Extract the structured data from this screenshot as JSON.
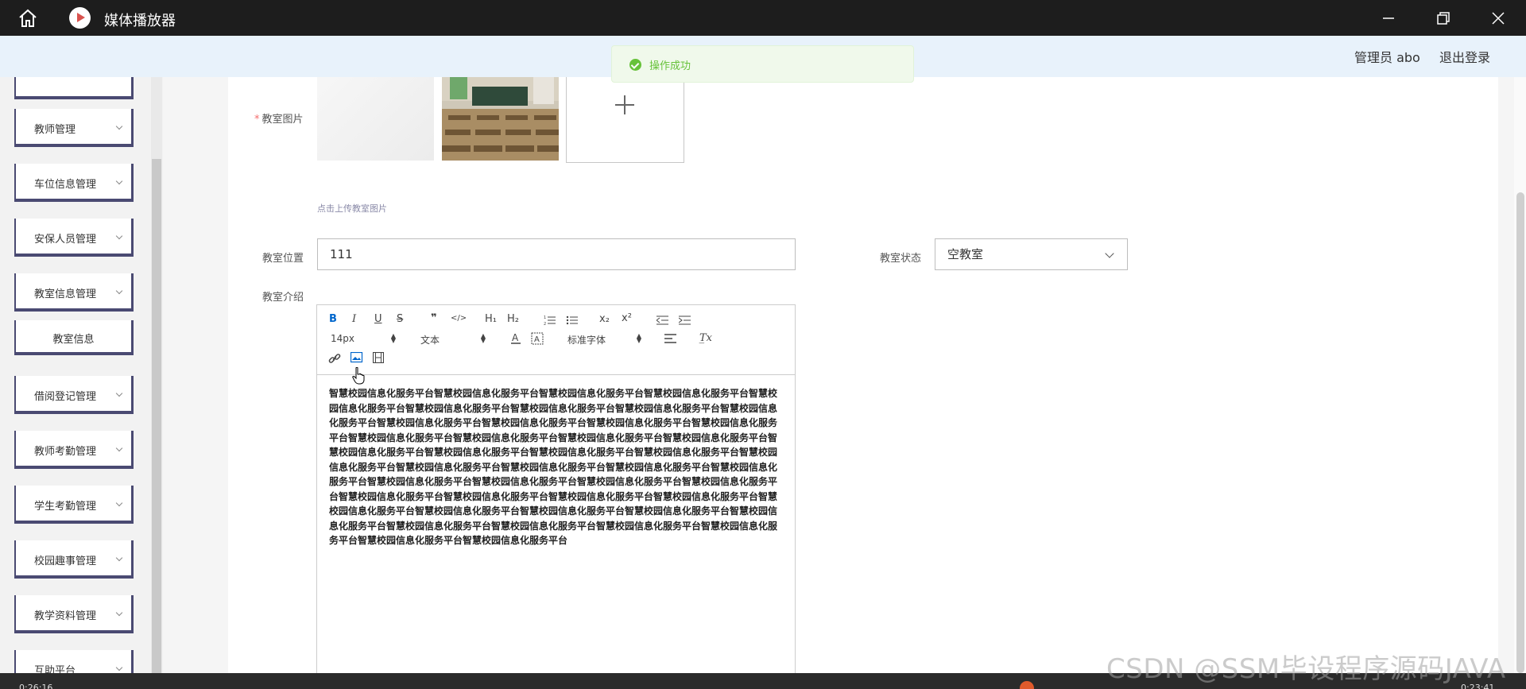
{
  "window": {
    "title": "媒体播放器",
    "minimize_icon": "minimize-icon",
    "maximize_icon": "restore-icon",
    "close_icon": "close-icon"
  },
  "header": {
    "admin_label": "管理员 abo",
    "logout_label": "退出登录"
  },
  "toast": {
    "message": "操作成功",
    "color": "#67c23a"
  },
  "sidebar": {
    "items": [
      {
        "label": ""
      },
      {
        "label": "教师管理"
      },
      {
        "label": "车位信息管理"
      },
      {
        "label": "安保人员管理"
      },
      {
        "label": "教室信息管理"
      },
      {
        "label": "教室信息"
      },
      {
        "label": "借阅登记管理"
      },
      {
        "label": "教师考勤管理"
      },
      {
        "label": "学生考勤管理"
      },
      {
        "label": "校园趣事管理"
      },
      {
        "label": "教学资料管理"
      },
      {
        "label": "互助平台"
      }
    ]
  },
  "form": {
    "image_label": "教室图片",
    "upload_hint": "点击上传教室图片",
    "location_label": "教室位置",
    "location_value": "111",
    "status_label": "教室状态",
    "status_value": "空教室",
    "intro_label": "教室介绍"
  },
  "editor": {
    "toolbar": {
      "bold": "B",
      "italic": "I",
      "underline": "U",
      "strike": "S",
      "quote": "❞",
      "code": "</>",
      "h1": "H₁",
      "h2": "H₂",
      "sub": "x₂",
      "sup": "x²",
      "font_size": "14px",
      "header_select": "文本",
      "font_family": "标准字体",
      "clear": "T̲x"
    },
    "content": "智慧校园信息化服务平台智慧校园信息化服务平台智慧校园信息化服务平台智慧校园信息化服务平台智慧校园信息化服务平台智慧校园信息化服务平台智慧校园信息化服务平台智慧校园信息化服务平台智慧校园信息化服务平台智慧校园信息化服务平台智慧校园信息化服务平台智慧校园信息化服务平台智慧校园信息化服务平台智慧校园信息化服务平台智慧校园信息化服务平台智慧校园信息化服务平台智慧校园信息化服务平台智慧校园信息化服务平台智慧校园信息化服务平台智慧校园信息化服务平台智慧校园信息化服务平台智慧校园信息化服务平台智慧校园信息化服务平台智慧校园信息化服务平台智慧校园信息化服务平台智慧校园信息化服务平台智慧校园信息化服务平台智慧校园信息化服务平台智慧校园信息化服务平台智慧校园信息化服务平台智慧校园信息化服务平台智慧校园信息化服务平台智慧校园信息化服务平台智慧校园信息化服务平台智慧校园信息化服务平台智慧校园信息化服务平台智慧校园信息化服务平台智慧校园信息化服务平台智慧校园信息化服务平台智慧校园信息化服务平台智慧校园信息化服务平台智慧校园信息化服务平台智慧校园信息化服务平台智慧校园信息化服务平台智慧校园信息化服务平台"
  },
  "media": {
    "elapsed": "0:26:16",
    "remaining": "0:23:41",
    "accent": "#e05a2b"
  },
  "watermark": "CSDN @SSM毕设程序源码JAVA"
}
